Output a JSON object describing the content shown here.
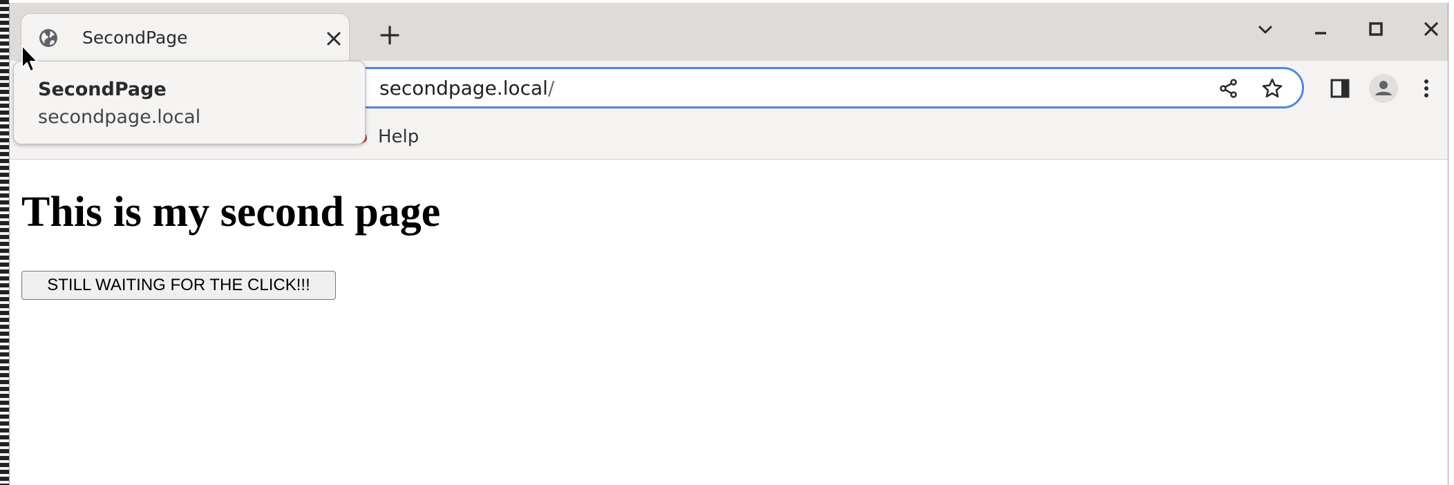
{
  "tab": {
    "title": "SecondPage"
  },
  "hover_card": {
    "title": "SecondPage",
    "domain": "secondpage.local"
  },
  "omnibox": {
    "host": "secondpage.local",
    "path": "/"
  },
  "bookmarks": {
    "help_label": "Help"
  },
  "page": {
    "heading": "This is my second page",
    "button_label": "STILL WAITING FOR THE CLICK!!!"
  },
  "icons": {
    "favicon": "globe-icon",
    "tab_close": "close-icon",
    "new_tab": "plus-icon",
    "tab_search": "chevron-down-icon",
    "minimize": "minimize-icon",
    "maximize": "maximize-icon",
    "window_close": "close-icon",
    "share": "share-icon",
    "bookmark": "star-icon",
    "side_panel": "side-panel-icon",
    "profile": "profile-icon",
    "menu": "kebab-menu-icon"
  },
  "colors": {
    "focus_ring": "#4e86e0",
    "tabstrip": "#dedbd8",
    "toolbar": "#f4f3f2"
  }
}
